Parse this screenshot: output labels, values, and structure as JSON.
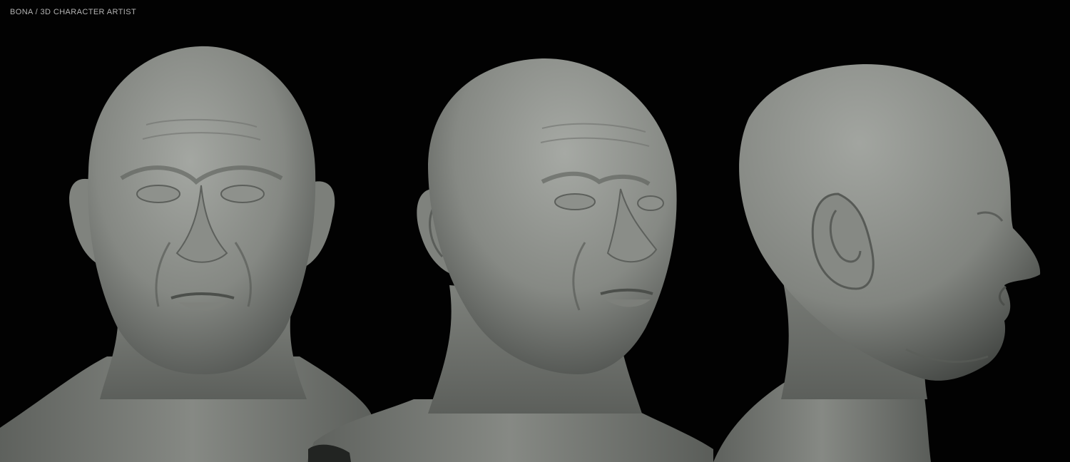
{
  "caption": "BONA / 3D CHARACTER ARTIST",
  "colors": {
    "background": "#020202",
    "clay_light": "#9a9d98",
    "clay_mid": "#777a76",
    "clay_dark": "#3c3f3c",
    "caption_text": "#b4b4b4"
  },
  "views": [
    {
      "id": "front",
      "label": "front view"
    },
    {
      "id": "three-quarter",
      "label": "three-quarter view"
    },
    {
      "id": "profile",
      "label": "profile view"
    }
  ]
}
